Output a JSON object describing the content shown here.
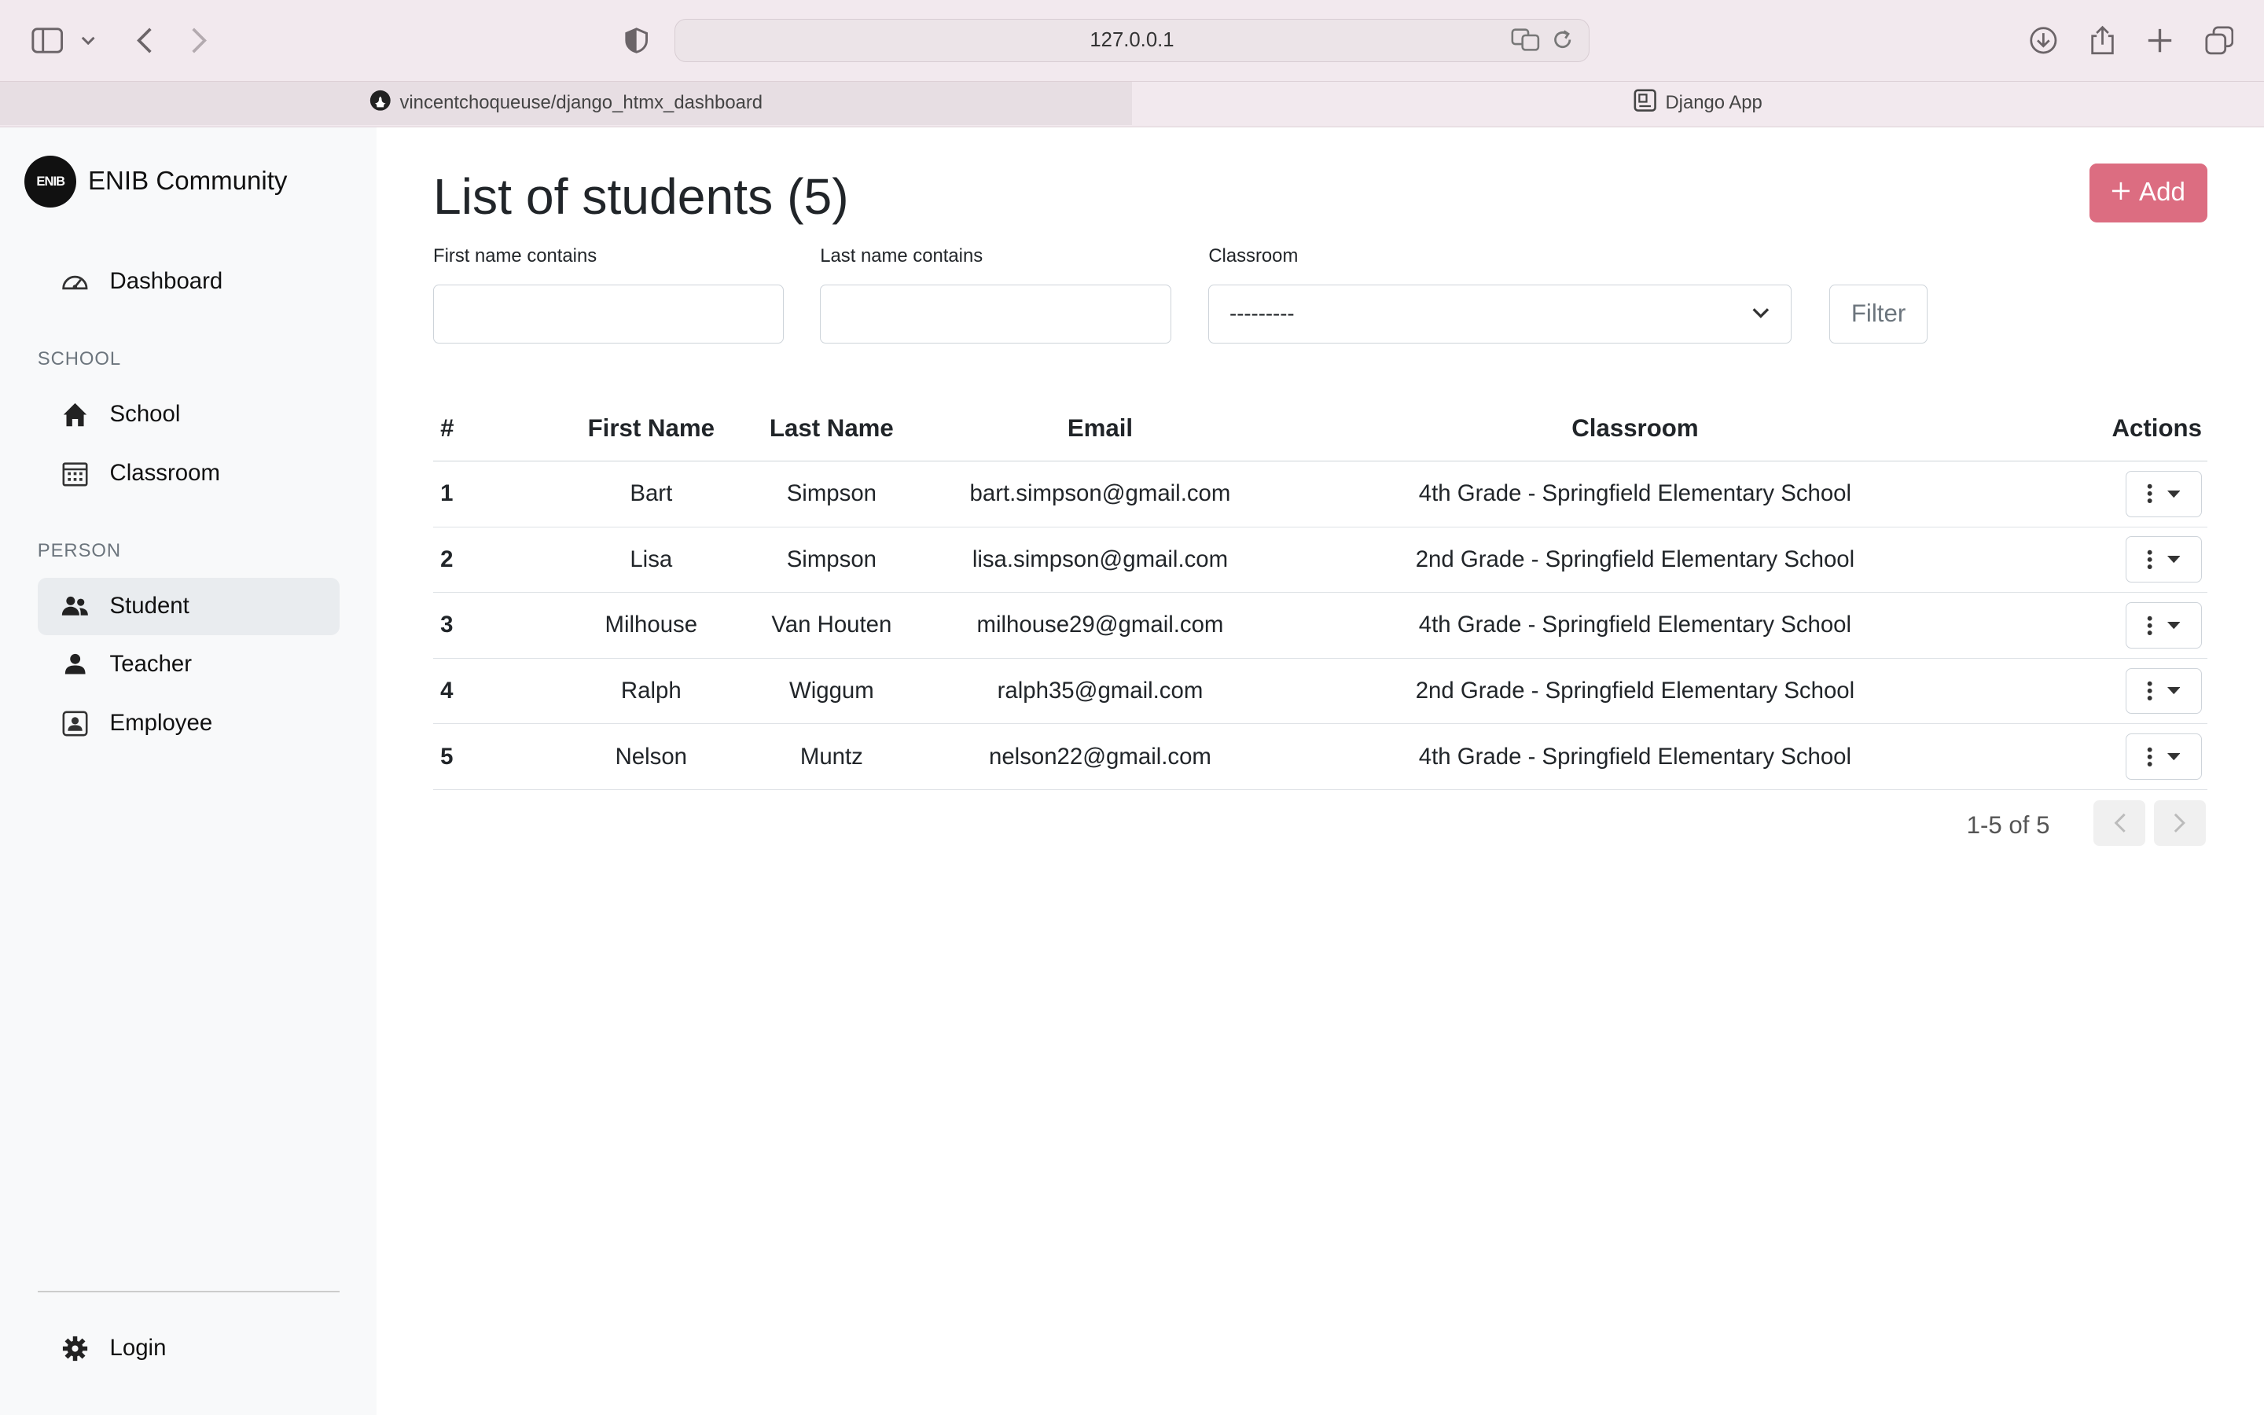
{
  "browser": {
    "url": "127.0.0.1",
    "tabs": [
      {
        "label": "vincentchoqueuse/django_htmx_dashboard",
        "icon": "github-icon"
      },
      {
        "label": "Django App",
        "icon": "page-icon"
      }
    ]
  },
  "sidebar": {
    "brand": "ENIB Community",
    "logo_text": "ENIB",
    "dashboard": "Dashboard",
    "section_school": "SCHOOL",
    "school": "School",
    "classroom": "Classroom",
    "section_person": "PERSON",
    "student": "Student",
    "teacher": "Teacher",
    "employee": "Employee",
    "login": "Login"
  },
  "main": {
    "title": "List of students (5)",
    "add_label": "Add",
    "filters": {
      "first_name_label": "First name contains",
      "last_name_label": "Last name contains",
      "classroom_label": "Classroom",
      "classroom_value": "---------",
      "filter_label": "Filter"
    },
    "table": {
      "headers": [
        "#",
        "First Name",
        "Last Name",
        "Email",
        "Classroom",
        "Actions"
      ],
      "rows": [
        {
          "num": "1",
          "first": "Bart",
          "last": "Simpson",
          "email": "bart.simpson@gmail.com",
          "classroom": "4th Grade - Springfield Elementary School"
        },
        {
          "num": "2",
          "first": "Lisa",
          "last": "Simpson",
          "email": "lisa.simpson@gmail.com",
          "classroom": "2nd Grade - Springfield Elementary School"
        },
        {
          "num": "3",
          "first": "Milhouse",
          "last": "Van Houten",
          "email": "milhouse29@gmail.com",
          "classroom": "4th Grade - Springfield Elementary School"
        },
        {
          "num": "4",
          "first": "Ralph",
          "last": "Wiggum",
          "email": "ralph35@gmail.com",
          "classroom": "2nd Grade - Springfield Elementary School"
        },
        {
          "num": "5",
          "first": "Nelson",
          "last": "Muntz",
          "email": "nelson22@gmail.com",
          "classroom": "4th Grade - Springfield Elementary School"
        }
      ]
    },
    "pagination": "1-5 of 5"
  },
  "colors": {
    "accent": "#dc6d81",
    "sidebar_bg": "#f8f9fa",
    "chrome_bg": "#f2e9ee"
  }
}
